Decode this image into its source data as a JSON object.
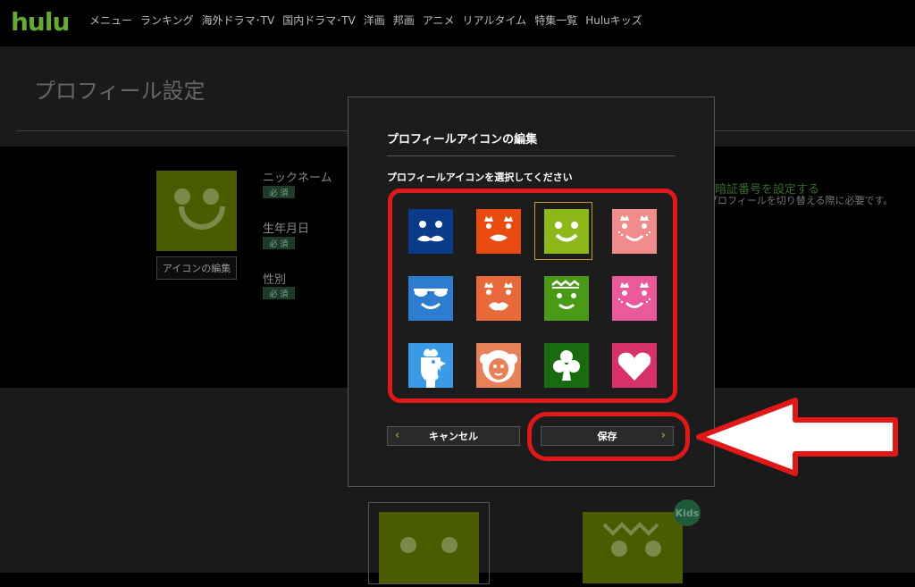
{
  "app": {
    "logo": "hulu"
  },
  "nav": {
    "items": [
      "メニュー",
      "ランキング",
      "海外ドラマ･TV",
      "国内ドラマ･TV",
      "洋画",
      "邦画",
      "アニメ",
      "リアルタイム",
      "特集一覧",
      "Huluキッズ"
    ]
  },
  "page": {
    "title": "プロフィール設定",
    "icon_edit_label": "アイコンの編集",
    "fields": [
      {
        "label": "ニックネーム",
        "badge": "必 須"
      },
      {
        "label": "生年月日",
        "badge": "必 須"
      },
      {
        "label": "性別",
        "badge": "必 須"
      }
    ],
    "right_note_link": "暗証番号を設定する",
    "right_note_text": "プロフィールを切り替える際に必要です。",
    "kids_badge": "Kids"
  },
  "modal": {
    "title": "プロフィールアイコンの編集",
    "subtitle": "プロフィールアイコンを選択してください",
    "selected_index": 2,
    "icons": [
      {
        "name": "mustache-face",
        "color": "#0a3a8a"
      },
      {
        "name": "crown-lips-face",
        "color": "#e84a10"
      },
      {
        "name": "smile-face",
        "color": "#8cb81a"
      },
      {
        "name": "blush-crown-face",
        "color": "#f08c8c"
      },
      {
        "name": "sunglasses-face",
        "color": "#2e7cd0"
      },
      {
        "name": "kiss-crown-face",
        "color": "#e86a3a"
      },
      {
        "name": "monster-face",
        "color": "#4a9a18"
      },
      {
        "name": "pink-blush-face",
        "color": "#ea5a9a"
      },
      {
        "name": "rooster",
        "color": "#3a9ae8"
      },
      {
        "name": "sheep",
        "color": "#e8805a"
      },
      {
        "name": "club-suit",
        "color": "#1a6a10"
      },
      {
        "name": "heart-suit",
        "color": "#d8306a"
      }
    ],
    "cancel_label": "キャンセル",
    "save_label": "保存"
  }
}
